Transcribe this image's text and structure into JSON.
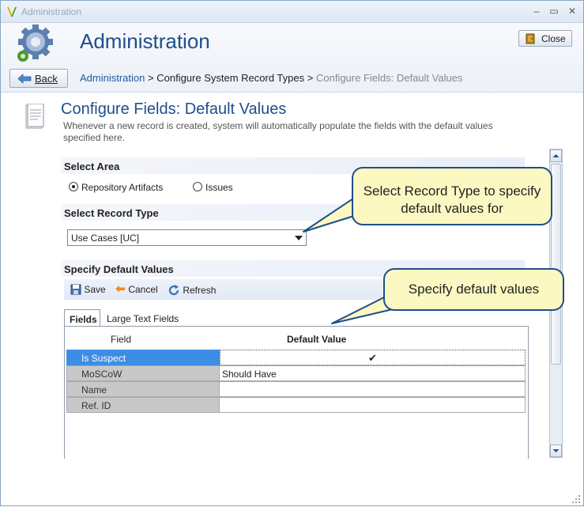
{
  "window": {
    "title": "Administration",
    "minimize": "–",
    "maximize": "▭",
    "close": "✕"
  },
  "header": {
    "app_title": "Administration",
    "close_label": "Close",
    "back_label": "Back"
  },
  "breadcrumb": {
    "items": [
      "Administration",
      "Configure System Record Types",
      "Configure Fields: Default Values"
    ],
    "separator": ">"
  },
  "page": {
    "title": "Configure Fields: Default Values",
    "description": "Whenever a new record is created, system will automatically populate the fields with the default values specified here."
  },
  "select_area": {
    "heading": "Select Area",
    "options": [
      {
        "label": "Repository Artifacts",
        "selected": true
      },
      {
        "label": "Issues",
        "selected": false
      }
    ]
  },
  "record_type": {
    "heading": "Select Record Type",
    "value": "Use Cases [UC]"
  },
  "defaults": {
    "heading": "Specify Default Values",
    "toolbar": {
      "save": "Save",
      "cancel": "Cancel",
      "refresh": "Refresh"
    },
    "tabs": [
      {
        "label": "Fields",
        "active": true
      },
      {
        "label": "Large Text Fields",
        "active": false
      }
    ],
    "columns": {
      "field": "Field",
      "value": "Default Value"
    },
    "rows": [
      {
        "field": "Is Suspect",
        "value": "",
        "checked": true,
        "selected": true
      },
      {
        "field": "MoSCoW",
        "value": "Should Have",
        "checked": false,
        "selected": false
      },
      {
        "field": "Name",
        "value": "",
        "checked": false,
        "selected": false
      },
      {
        "field": "Ref. ID",
        "value": "",
        "checked": false,
        "selected": false
      }
    ]
  },
  "callouts": {
    "record_type": "Select Record Type to specify default values for",
    "default_values": "Specify default values"
  },
  "colors": {
    "accent": "#1f4e8c",
    "selection": "#3c8ee4",
    "callout_fill": "#fbf8c2"
  }
}
